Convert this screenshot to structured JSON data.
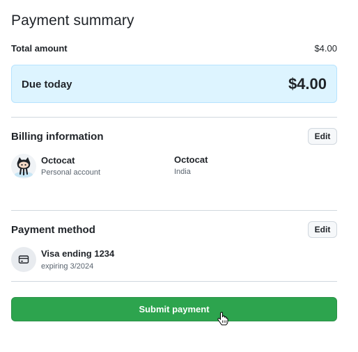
{
  "header": {
    "title": "Payment summary"
  },
  "total": {
    "label": "Total amount",
    "value": "$4.00"
  },
  "due": {
    "label": "Due today",
    "value": "$4.00"
  },
  "billing": {
    "title": "Billing information",
    "edit_label": "Edit",
    "account_name": "Octocat",
    "account_type": "Personal account",
    "billing_name": "Octocat",
    "country": "India"
  },
  "payment": {
    "title": "Payment method",
    "edit_label": "Edit",
    "card_label": "Visa ending 1234",
    "expiry": "expiring 3/2024"
  },
  "submit": {
    "label": "Submit payment"
  },
  "colors": {
    "accent_green": "#2da44e",
    "due_background": "#ddf4ff",
    "divider": "#d0d7de"
  },
  "icons": {
    "avatar": "octocat-avatar-icon",
    "card": "credit-card-icon",
    "cursor": "hand-pointer-icon"
  }
}
